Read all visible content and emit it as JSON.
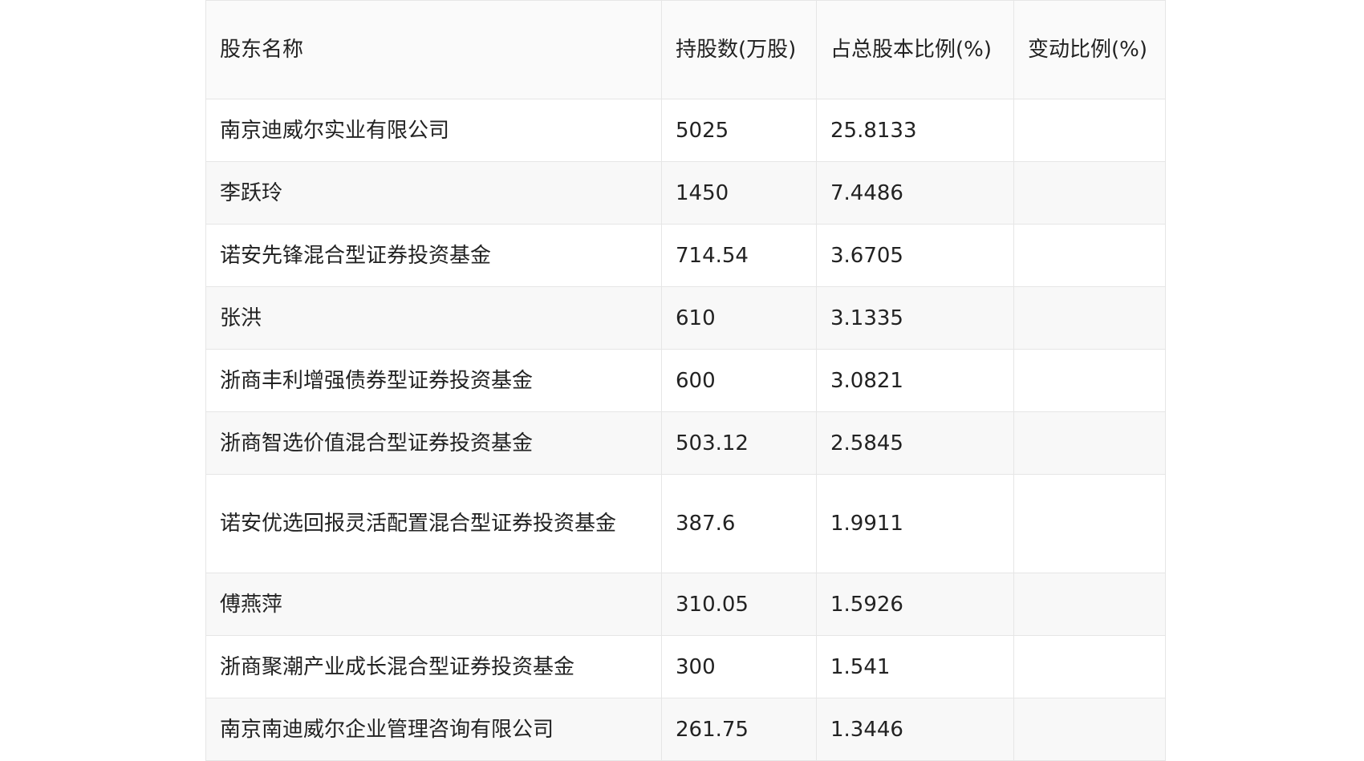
{
  "table": {
    "headers": [
      "股东名称",
      "持股数(万股)",
      "占总股本比例(%)",
      "变动比例(%)"
    ],
    "rows": [
      {
        "name": "南京迪威尔实业有限公司",
        "shares": "5025",
        "ratio": "25.8133",
        "change": ""
      },
      {
        "name": "李跃玲",
        "shares": "1450",
        "ratio": "7.4486",
        "change": ""
      },
      {
        "name": "诺安先锋混合型证券投资基金",
        "shares": "714.54",
        "ratio": "3.6705",
        "change": ""
      },
      {
        "name": "张洪",
        "shares": "610",
        "ratio": "3.1335",
        "change": ""
      },
      {
        "name": "浙商丰利增强债券型证券投资基金",
        "shares": "600",
        "ratio": "3.0821",
        "change": ""
      },
      {
        "name": "浙商智选价值混合型证券投资基金",
        "shares": "503.12",
        "ratio": "2.5845",
        "change": ""
      },
      {
        "name": "诺安优选回报灵活配置混合型证券投资基金",
        "shares": "387.6",
        "ratio": "1.9911",
        "change": ""
      },
      {
        "name": "傅燕萍",
        "shares": "310.05",
        "ratio": "1.5926",
        "change": ""
      },
      {
        "name": "浙商聚潮产业成长混合型证券投资基金",
        "shares": "300",
        "ratio": "1.541",
        "change": ""
      },
      {
        "name": "南京南迪威尔企业管理咨询有限公司",
        "shares": "261.75",
        "ratio": "1.3446",
        "change": ""
      }
    ]
  }
}
